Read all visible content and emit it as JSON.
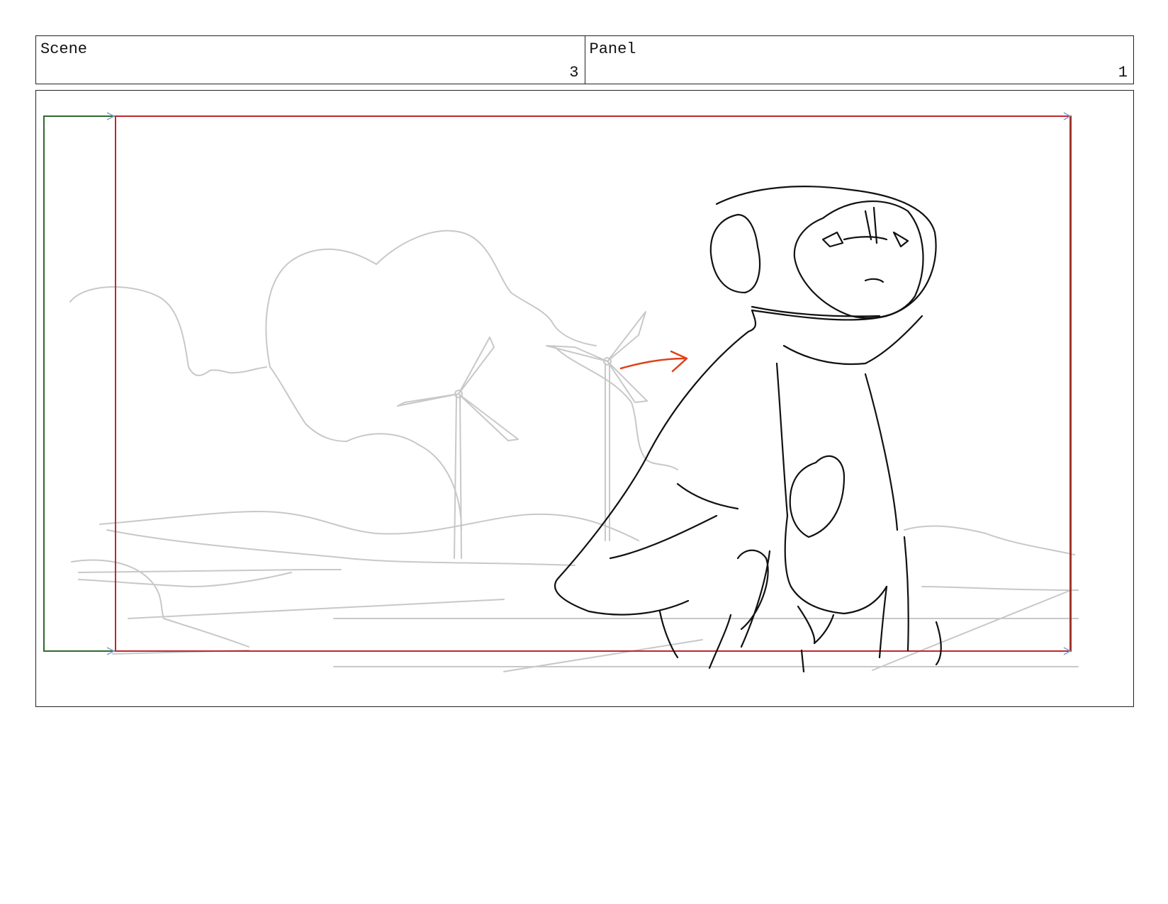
{
  "header": {
    "scene_label": "Scene",
    "scene_value": "3",
    "panel_label": "Panel",
    "panel_value": "1"
  },
  "colors": {
    "safe_frame": "#c0272d",
    "field_frame": "#2e6b2e",
    "direction_arrow": "#e0401b",
    "background_sketch": "#c8c8c8",
    "character_sketch": "#111111"
  },
  "drawing": {
    "character": "hooded-round-headed-creature",
    "background": [
      "clouds",
      "wind-turbines",
      "hills"
    ]
  }
}
